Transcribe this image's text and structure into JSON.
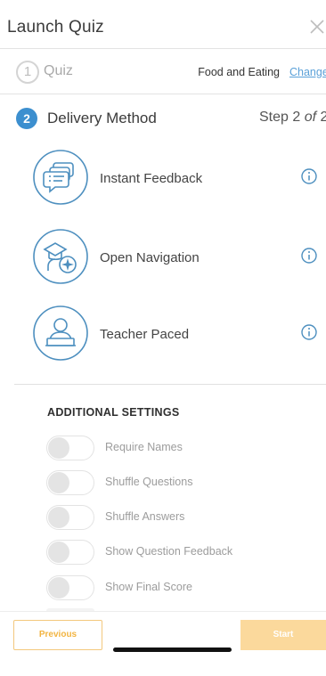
{
  "header": {
    "title": "Launch Quiz",
    "close_icon": "close-icon"
  },
  "step1": {
    "number": "1",
    "label": "Quiz",
    "topic": "Food and Eating",
    "change_link": "Change"
  },
  "step2": {
    "number": "2",
    "label": "Delivery Method",
    "step_prefix": "Step 2 ",
    "step_of": "of",
    "step_total": " 2"
  },
  "methods": [
    {
      "label": "Instant Feedback",
      "icon": "feedback-bubbles-icon"
    },
    {
      "label": "Open Navigation",
      "icon": "compass-navigation-icon"
    },
    {
      "label": "Teacher Paced",
      "icon": "teacher-icon"
    }
  ],
  "settings": {
    "title": "ADDITIONAL SETTINGS",
    "toggles": [
      {
        "label": "Require Names",
        "on": false
      },
      {
        "label": "Shuffle Questions",
        "on": false
      },
      {
        "label": "Shuffle Answers",
        "on": false
      },
      {
        "label": "Show Question Feedback",
        "on": false
      },
      {
        "label": "Show Final Score",
        "on": false
      }
    ]
  },
  "footer": {
    "previous_label": "Previous",
    "start_label": "Start"
  },
  "colors": {
    "accent_blue": "#3c8fcf",
    "icon_blue": "#4d8fbf",
    "orange": "#f2b441",
    "start_disabled": "#fbd99c"
  }
}
